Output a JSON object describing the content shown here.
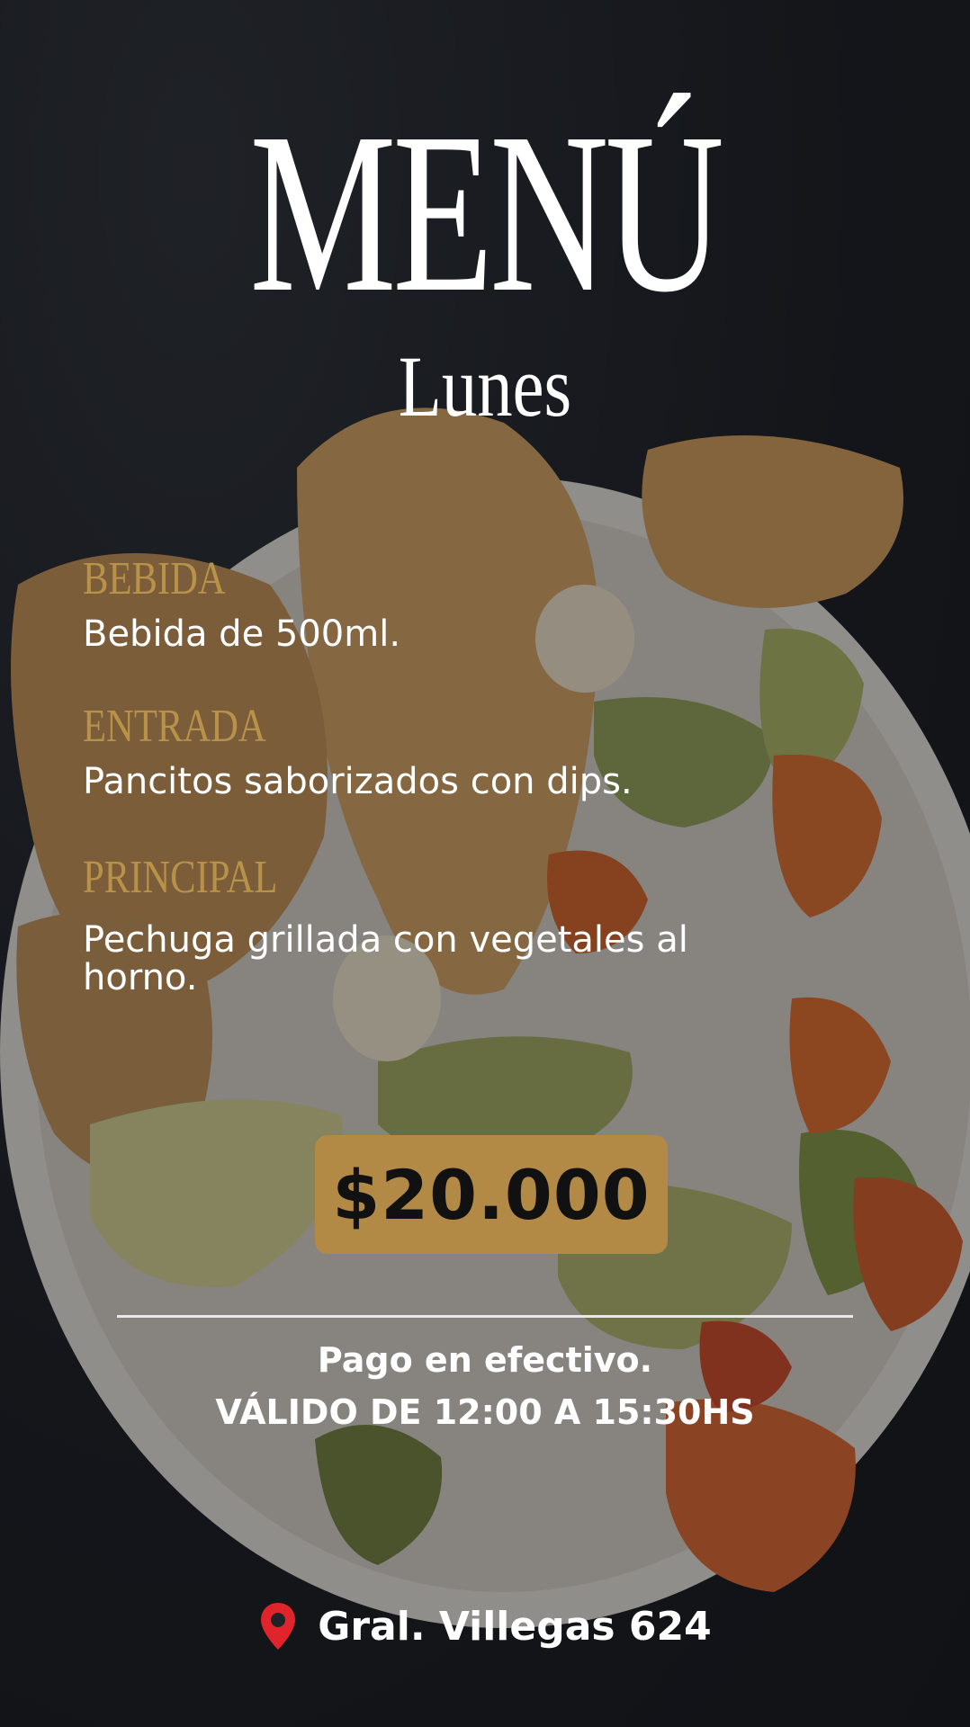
{
  "header": {
    "title": "MENÚ",
    "day": "Lunes"
  },
  "sections": [
    {
      "heading": "BEBIDA",
      "text": "Bebida de 500ml."
    },
    {
      "heading": "ENTRADA",
      "text": "Pancitos saborizados con dips."
    },
    {
      "heading": "PRINCIPAL",
      "text": "Pechuga grillada con vegetales al horno."
    }
  ],
  "price": "$20.000",
  "notes": {
    "payment": "Pago en efectivo.",
    "hours": "VÁLIDO DE 12:00 A 15:30HS"
  },
  "location": {
    "icon": "map-pin-icon",
    "address": "Gral. Villegas 624"
  },
  "colors": {
    "accent": "#b28a46",
    "heading_gold": "#b9924a",
    "pin_red": "#e0242b",
    "text": "#ffffff"
  }
}
